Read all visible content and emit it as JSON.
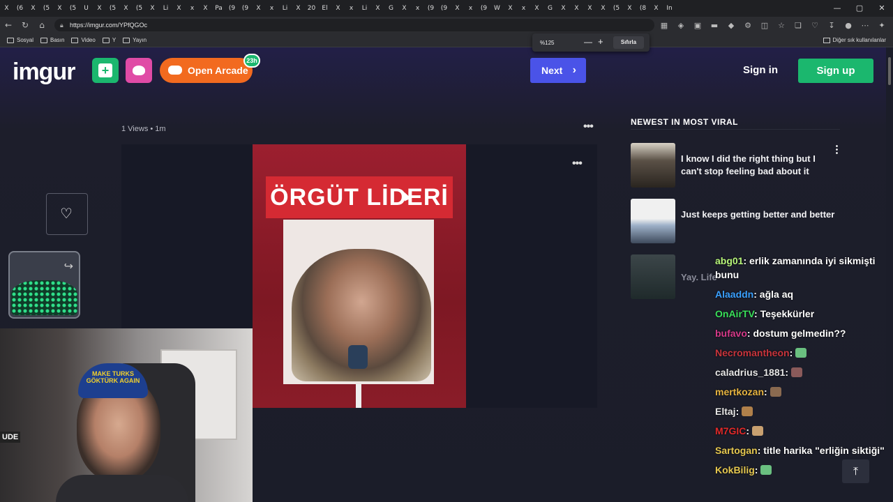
{
  "browser": {
    "tab_glyphs": [
      "X",
      "(6",
      "X",
      "(5",
      "X",
      "(5",
      "U",
      "X",
      "(5",
      "X",
      "(5",
      "X",
      "Li",
      "X",
      "x",
      "X",
      "Pa",
      "(9",
      "(9",
      "X",
      "x",
      "Li",
      "X",
      "20",
      "El",
      "X",
      "x",
      "Li",
      "X",
      "G",
      "X",
      "x",
      "(9",
      "(9",
      "X",
      "x",
      "(9",
      "W",
      "X",
      "x",
      "X",
      "G",
      "X",
      "X",
      "X",
      "X",
      "(5",
      "X",
      "(8",
      "X",
      "In"
    ],
    "window_controls": [
      "—",
      "▢",
      "✕"
    ],
    "url": "https://imgur.com/YPfQGOc",
    "zoom": {
      "percent": "%125",
      "minus": "—",
      "plus": "+",
      "reset": "Sıfırla"
    },
    "bookmarks": [
      "Sosyal",
      "Basın",
      "Video",
      "Y",
      "Yayın"
    ],
    "bookmarks_right": "Diğer sık kullanılanlar"
  },
  "header": {
    "logo": "imgur",
    "new_post_icon": "plus-square-icon",
    "arcade_label": "Open Arcade",
    "arcade_badge": "23h",
    "next_label": "Next",
    "signin_label": "Sign in",
    "signup_label": "Sign up"
  },
  "post": {
    "meta": "1 Views • 1m",
    "banner_text": "ÖRGÜT LİDERİ",
    "more": "•••"
  },
  "viral": {
    "title": "NEWEST IN MOST VIRAL",
    "items": [
      {
        "title": "I know I did the right thing but I can't stop feeling bad about it"
      },
      {
        "title": "Just keeps getting better and better"
      },
      {
        "title": "Yay. Life"
      }
    ]
  },
  "webcam": {
    "hat_text": "MAKE TURKS GÖKTÜRK AGAIN",
    "side_text": "UDE"
  },
  "chat": [
    {
      "user": "abg01",
      "color": "#b7f57a",
      "text": "erlik zamanında iyi sikmişti bunu"
    },
    {
      "user": "Alaaddn",
      "color": "#3aa0ff",
      "text": "ağla aq"
    },
    {
      "user": "OnAirTV",
      "color": "#39e05a",
      "text": "Teşekkürler"
    },
    {
      "user": "bufavo",
      "color": "#d63a8a",
      "text": "dostum gelmedin??"
    },
    {
      "user": "Necromantheon",
      "color": "#c8343c",
      "text": ""
    },
    {
      "user": "caladrius_1881",
      "color": "#e6e6e6",
      "text": ""
    },
    {
      "user": "mertkozan",
      "color": "#e6b340",
      "text": ""
    },
    {
      "user": "Eltaj",
      "color": "#e6e6e6",
      "text": ""
    },
    {
      "user": "M7GIC",
      "color": "#e02a2a",
      "text": ""
    },
    {
      "user": "Sartogan",
      "color": "#e6c850",
      "text": "title harika \"erliğin siktiği\""
    },
    {
      "user": "KokBilig",
      "color": "#e6c850",
      "text": ""
    }
  ],
  "to_top": "⤒"
}
